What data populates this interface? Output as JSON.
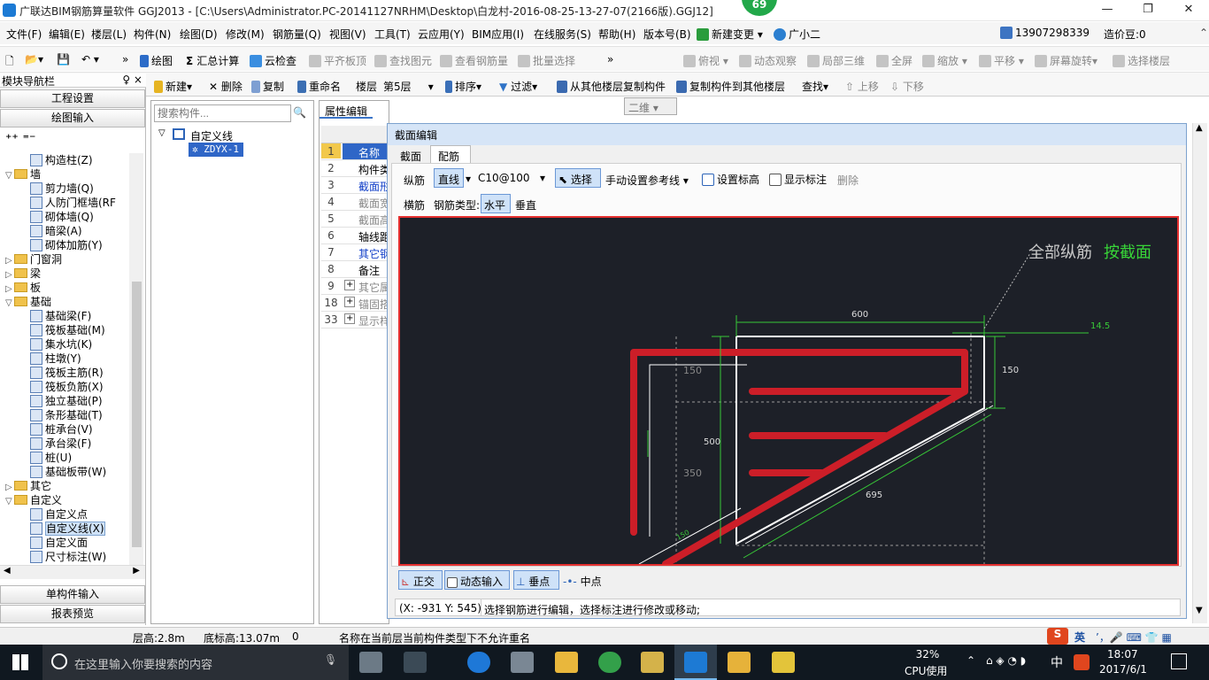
{
  "window": {
    "title": "广联达BIM钢筋算量软件 GGJ2013 - [C:\\Users\\Administrator.PC-20141127NRHM\\Desktop\\白龙村-2016-08-25-13-27-07(2166版).GGJ12]",
    "badge": "69"
  },
  "menu": {
    "items": [
      "文件(F)",
      "编辑(E)",
      "楼层(L)",
      "构件(N)",
      "绘图(D)",
      "修改(M)",
      "钢筋量(Q)",
      "视图(V)",
      "工具(T)",
      "云应用(Y)",
      "BIM应用(I)",
      "在线服务(S)",
      "帮助(H)",
      "版本号(B)"
    ],
    "new_change": "新建变更",
    "assistant": "广小二",
    "phone": "13907298339",
    "price": "造价豆:0"
  },
  "toolbar1": {
    "draw": "绘图",
    "sum": "汇总计算",
    "cloud": "云检查",
    "flat": "平齐板顶",
    "find": "查找图元",
    "view_rebar": "查看钢筋量",
    "batch": "批量选择",
    "view_mode": "二维",
    "top_view": "俯视",
    "dynamic": "动态观察",
    "local3d": "局部三维",
    "full": "全屏",
    "zoom": "缩放",
    "pan": "平移",
    "rotate": "屏幕旋转",
    "select_floor": "选择楼层"
  },
  "toolbar2": {
    "new": "新建",
    "delete": "删除",
    "copy": "复制",
    "rename": "重命名",
    "floor_label": "楼层",
    "floor": "第5层",
    "sort": "排序",
    "filter": "过滤",
    "copy_from": "从其他楼层复制构件",
    "copy_to": "复制构件到其他楼层",
    "find": "查找",
    "up": "上移",
    "down": "下移"
  },
  "nav": {
    "header": "模块导航栏",
    "pin": "♀ ×",
    "project": "工程设置",
    "draw_input": "绘图输入",
    "single": "单构件输入",
    "report": "报表预览",
    "tree": [
      {
        "label": "构造柱(Z)",
        "lvl": 2,
        "kind": "leaf"
      },
      {
        "label": "墙",
        "lvl": 1,
        "kind": "folder",
        "open": true
      },
      {
        "label": "剪力墙(Q)",
        "lvl": 2,
        "kind": "leaf"
      },
      {
        "label": "人防门框墙(RF",
        "lvl": 2,
        "kind": "leaf"
      },
      {
        "label": "砌体墙(Q)",
        "lvl": 2,
        "kind": "leaf"
      },
      {
        "label": "暗梁(A)",
        "lvl": 2,
        "kind": "leaf"
      },
      {
        "label": "砌体加筋(Y)",
        "lvl": 2,
        "kind": "leaf"
      },
      {
        "label": "门窗洞",
        "lvl": 1,
        "kind": "folder",
        "open": false
      },
      {
        "label": "梁",
        "lvl": 1,
        "kind": "folder",
        "open": false
      },
      {
        "label": "板",
        "lvl": 1,
        "kind": "folder",
        "open": false
      },
      {
        "label": "基础",
        "lvl": 1,
        "kind": "folder",
        "open": true
      },
      {
        "label": "基础梁(F)",
        "lvl": 2,
        "kind": "leaf"
      },
      {
        "label": "筏板基础(M)",
        "lvl": 2,
        "kind": "leaf"
      },
      {
        "label": "集水坑(K)",
        "lvl": 2,
        "kind": "leaf"
      },
      {
        "label": "柱墩(Y)",
        "lvl": 2,
        "kind": "leaf"
      },
      {
        "label": "筏板主筋(R)",
        "lvl": 2,
        "kind": "leaf"
      },
      {
        "label": "筏板负筋(X)",
        "lvl": 2,
        "kind": "leaf"
      },
      {
        "label": "独立基础(P)",
        "lvl": 2,
        "kind": "leaf"
      },
      {
        "label": "条形基础(T)",
        "lvl": 2,
        "kind": "leaf"
      },
      {
        "label": "桩承台(V)",
        "lvl": 2,
        "kind": "leaf"
      },
      {
        "label": "承台梁(F)",
        "lvl": 2,
        "kind": "leaf"
      },
      {
        "label": "桩(U)",
        "lvl": 2,
        "kind": "leaf"
      },
      {
        "label": "基础板带(W)",
        "lvl": 2,
        "kind": "leaf"
      },
      {
        "label": "其它",
        "lvl": 1,
        "kind": "folder",
        "open": false
      },
      {
        "label": "自定义",
        "lvl": 1,
        "kind": "folder",
        "open": true
      },
      {
        "label": "自定义点",
        "lvl": 2,
        "kind": "leaf"
      },
      {
        "label": "自定义线(X)",
        "lvl": 2,
        "kind": "leaf",
        "selected": true
      },
      {
        "label": "自定义面",
        "lvl": 2,
        "kind": "leaf"
      },
      {
        "label": "尺寸标注(W)",
        "lvl": 2,
        "kind": "leaf"
      }
    ]
  },
  "components": {
    "search_placeholder": "搜索构件...",
    "root": "自定义线",
    "item": "ZDYX-1"
  },
  "props": {
    "tab": "属性编辑",
    "rows": [
      {
        "n": "1",
        "label": "名称",
        "style": "sel"
      },
      {
        "n": "2",
        "label": "构件类",
        "style": "normal"
      },
      {
        "n": "3",
        "label": "截面形",
        "style": "blue"
      },
      {
        "n": "4",
        "label": "截面宽",
        "style": "gray"
      },
      {
        "n": "5",
        "label": "截面高",
        "style": "gray"
      },
      {
        "n": "6",
        "label": "轴线距",
        "style": "normal"
      },
      {
        "n": "7",
        "label": "其它钢",
        "style": "blue"
      },
      {
        "n": "8",
        "label": "备注",
        "style": "normal"
      },
      {
        "n": "9",
        "label": "其它属",
        "style": "gray",
        "plus": true
      },
      {
        "n": "18",
        "label": "锚固搭",
        "style": "gray",
        "plus": true
      },
      {
        "n": "33",
        "label": "显示样",
        "style": "gray",
        "plus": true
      }
    ]
  },
  "dialog": {
    "title": "截面编辑",
    "tabs": [
      "截面",
      "配筋"
    ],
    "active_tab": "配筋",
    "row1": {
      "longitudinal": "纵筋",
      "line": "直线",
      "spec": "C10@100",
      "select": "选择",
      "manual_ref": "手动设置参考线",
      "set_elev": "设置标高",
      "show_dim": "显示标注",
      "delete": "删除"
    },
    "row2": {
      "transverse": "横筋",
      "type_label": "钢筋类型:",
      "horizontal": "水平",
      "vertical": "垂直"
    },
    "canvas": {
      "label_all": "全部纵筋",
      "label_section": "按截面",
      "dims": {
        "top": "600",
        "right": "150",
        "total": "500",
        "inner": "350",
        "slope": "695",
        "left_top": "150",
        "elev": "14.5",
        "small": "150"
      }
    },
    "snap": {
      "ortho": "正交",
      "dynamic_input": "动态输入",
      "perpendicular": "垂点",
      "midpoint": "中点"
    },
    "coords": "(X: -931 Y: 545)",
    "hint": "选择钢筋进行编辑，选择标注进行修改或移动;"
  },
  "statusbar": {
    "floor_height": "层高:2.8m",
    "bottom_elev": "底标高:13.07m",
    "zero": "0",
    "message": "名称在当前层当前构件类型下不允许重名"
  },
  "taskbar": {
    "search": "在这里输入你要搜索的内容",
    "cpu": "32%",
    "cpu_label": "CPU使用",
    "ime": "中",
    "time": "18:07",
    "date": "2017/6/1",
    "tray_ime": "英"
  },
  "colors": {
    "canvas_bg": "#1d2028",
    "rebar": "#cc1e28",
    "dim": "#38c838",
    "outline": "#ffffff"
  }
}
